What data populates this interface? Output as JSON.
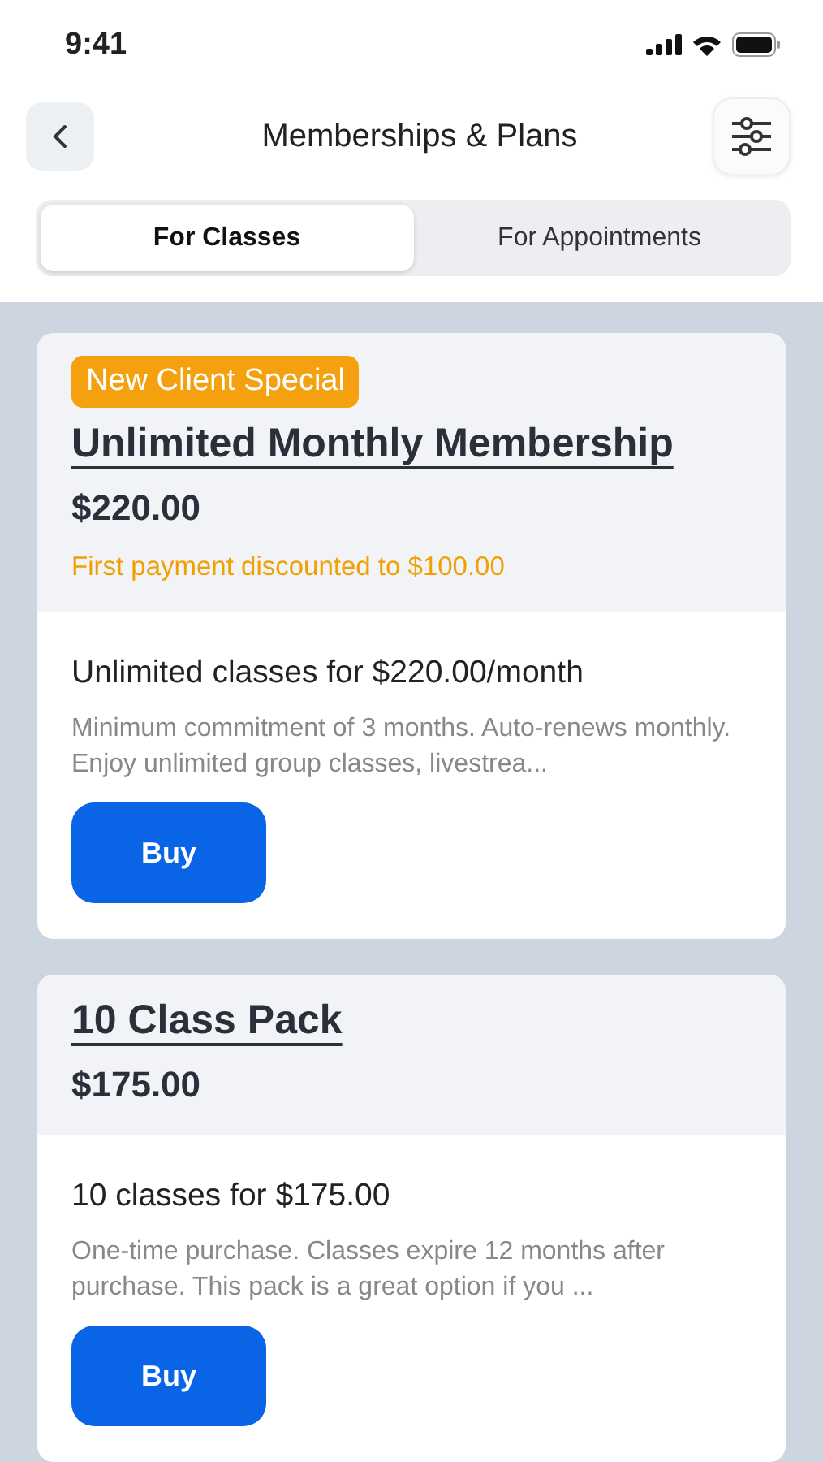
{
  "status_bar": {
    "time": "9:41"
  },
  "header": {
    "title": "Memberships & Plans"
  },
  "tabs": [
    {
      "label": "For Classes",
      "selected": true
    },
    {
      "label": "For Appointments",
      "selected": false
    }
  ],
  "plans": [
    {
      "badge": "New Client Special",
      "title": "Unlimited Monthly Membership",
      "price": "$220.00",
      "promo": "First payment discounted to $100.00",
      "heading": "Unlimited classes for $220.00/month",
      "description": "Minimum commitment of 3 months. Auto-renews monthly. Enjoy unlimited group classes, livestrea...",
      "button": "Buy"
    },
    {
      "title": "10 Class Pack",
      "price": "$175.00",
      "heading": "10 classes for $175.00",
      "description": "One-time purchase. Classes expire 12 months after purchase. This pack is a great option if you ...",
      "button": "Buy"
    }
  ]
}
